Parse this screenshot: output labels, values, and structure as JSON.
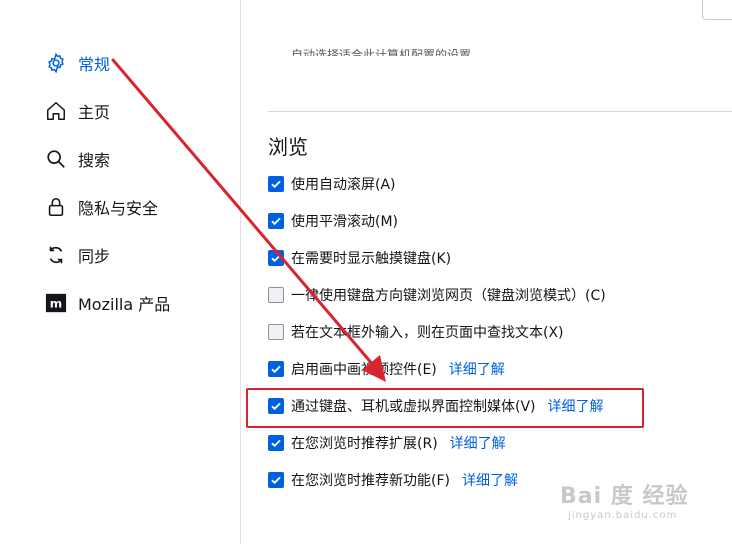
{
  "sidebar": {
    "items": [
      {
        "label": "常规",
        "icon": "gear-icon",
        "active": true
      },
      {
        "label": "主页",
        "icon": "home-icon",
        "active": false
      },
      {
        "label": "搜索",
        "icon": "search-icon",
        "active": false
      },
      {
        "label": "隐私与安全",
        "icon": "lock-icon",
        "active": false
      },
      {
        "label": "同步",
        "icon": "sync-icon",
        "active": false
      },
      {
        "label": "Mozilla 产品",
        "icon": "mozilla-icon",
        "active": false
      }
    ]
  },
  "main": {
    "partial_text": "自动选择适合此计算机配置的设置。",
    "section_title": "浏览",
    "options": [
      {
        "label": "使用自动滚屏(A)",
        "checked": true
      },
      {
        "label": "使用平滑滚动(M)",
        "checked": true
      },
      {
        "label": "在需要时显示触摸键盘(K)",
        "checked": true
      },
      {
        "label": "一律使用键盘方向键浏览网页（键盘浏览模式）(C)",
        "checked": false
      },
      {
        "label": "若在文本框外输入，则在页面中查找文本(X)",
        "checked": false
      },
      {
        "label": "启用画中画视频控件(E)",
        "checked": true,
        "more": "详细了解"
      },
      {
        "label": "通过键盘、耳机或虚拟界面控制媒体(V)",
        "checked": true,
        "more": "详细了解"
      },
      {
        "label": "在您浏览时推荐扩展(R)",
        "checked": true,
        "more": "详细了解"
      },
      {
        "label": "在您浏览时推荐新功能(F)",
        "checked": true,
        "more": "详细了解"
      }
    ]
  },
  "watermark": {
    "main": "Bai 度 经验",
    "sub": "jingyan.baidu.com"
  },
  "colors": {
    "accent": "#0061e0",
    "annotation": "#d8242d"
  }
}
